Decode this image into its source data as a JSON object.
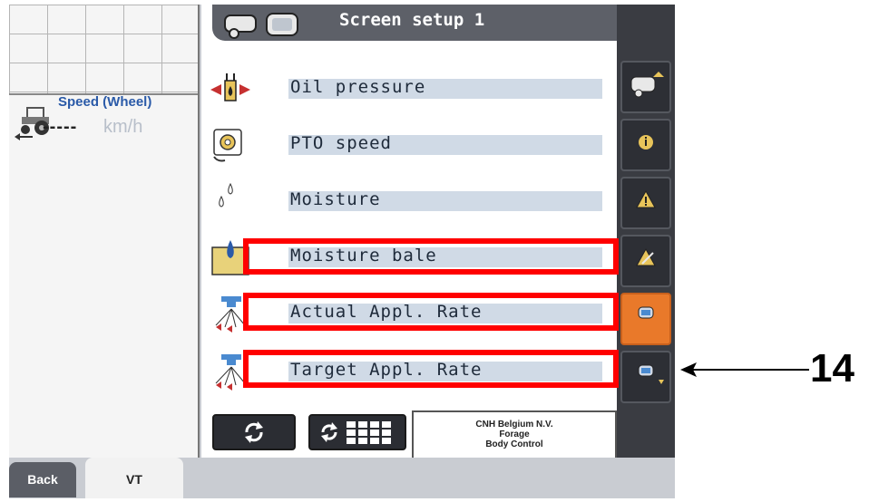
{
  "left_panel": {
    "speed_title": "Speed (Wheel)",
    "speed_value": "-----",
    "speed_unit": "km/h"
  },
  "header": {
    "title": "Screen setup 1"
  },
  "rows": [
    {
      "label": "Oil pressure",
      "icon": "oil-pressure-icon"
    },
    {
      "label": "PTO speed",
      "icon": "pto-speed-icon"
    },
    {
      "label": "Moisture",
      "icon": "moisture-icon"
    },
    {
      "label": "Moisture bale",
      "icon": "moisture-bale-icon"
    },
    {
      "label": "Actual Appl. Rate",
      "icon": "actual-appl-rate-icon"
    },
    {
      "label": "Target Appl. Rate",
      "icon": "target-appl-rate-icon"
    }
  ],
  "company": {
    "line1": "CNH Belgium N.V.",
    "line2": "Forage",
    "line3": "Body Control"
  },
  "side_buttons": [
    {
      "icon": "baler-up-icon"
    },
    {
      "icon": "info-icon"
    },
    {
      "icon": "warning-icon"
    },
    {
      "icon": "warning-list-icon"
    },
    {
      "icon": "screen-setup-icon",
      "active": true
    },
    {
      "icon": "screen-setup-more-icon"
    }
  ],
  "tabs": {
    "back": "Back",
    "vt": "VT"
  },
  "annotation": {
    "number": "14"
  },
  "colors": {
    "highlight": "#ff0000",
    "active_button": "#e9792a",
    "title_bar": "#5d6068"
  }
}
